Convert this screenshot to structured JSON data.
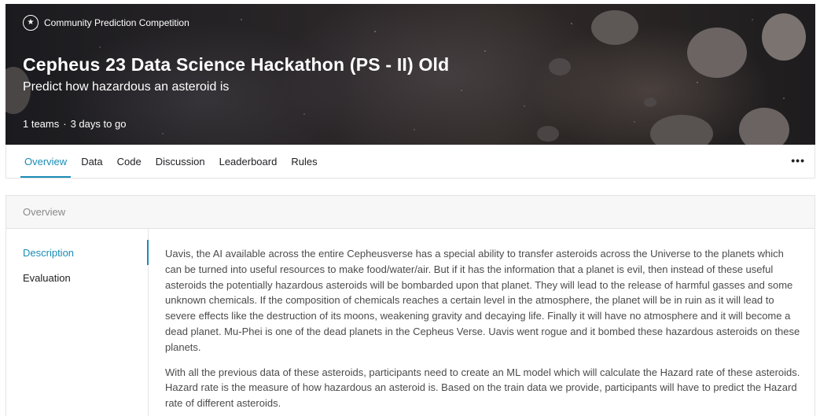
{
  "header": {
    "badge": "Community Prediction Competition",
    "badge_icon": "trophy-icon",
    "title": "Cepheus 23 Data Science Hackathon (PS - II) Old",
    "subtitle": "Predict how hazardous an asteroid is",
    "teams": "1 teams",
    "separator": "·",
    "time_left": "3 days to go"
  },
  "tabs": [
    {
      "label": "Overview",
      "active": true
    },
    {
      "label": "Data",
      "active": false
    },
    {
      "label": "Code",
      "active": false
    },
    {
      "label": "Discussion",
      "active": false
    },
    {
      "label": "Leaderboard",
      "active": false
    },
    {
      "label": "Rules",
      "active": false
    }
  ],
  "more_menu": "•••",
  "overview": {
    "heading": "Overview",
    "sidebar": [
      {
        "label": "Description",
        "active": true
      },
      {
        "label": "Evaluation",
        "active": false
      }
    ],
    "paragraphs": [
      "Uavis, the AI available across the entire Cepheusverse has a special ability to transfer asteroids across the Universe to the planets which can be turned into useful resources to make food/water/air. But if it has the information that a planet is evil, then instead of these useful asteroids the potentially hazardous asteroids will be bombarded upon that planet. They will lead to the release of harmful gasses and some unknown chemicals. If the composition of chemicals reaches a certain level in the atmosphere, the planet will be in ruin as it will lead to severe effects like the destruction of its moons, weakening gravity and decaying life. Finally it will have no atmosphere and it will become a dead planet. Mu-Phei is one of the dead planets in the Cepheus Verse. Uavis went rogue and it bombed these hazardous asteroids on these planets.",
      "With all the previous data of these asteroids, participants need to create an ML model which will calculate the Hazard rate of these asteroids. Hazard rate is the measure of how hazardous an asteroid is. Based on the train data we provide, participants will have to predict the Hazard rate of different asteroids."
    ]
  },
  "colors": {
    "accent": "#1a8cb5",
    "border": "#e3e3e3",
    "text": "#202124",
    "muted": "#8a8a8a"
  }
}
